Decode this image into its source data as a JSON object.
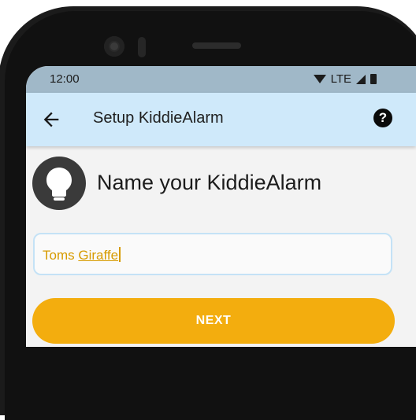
{
  "status_bar": {
    "time": "12:00",
    "network": "LTE",
    "icons": [
      "wifi-icon",
      "signal-icon",
      "battery-icon"
    ]
  },
  "app_bar": {
    "title": "Setup KiddieAlarm",
    "back_icon": "back-arrow-icon",
    "help_icon": "help-icon",
    "help_glyph": "?"
  },
  "content": {
    "heading_icon": "lightbulb-icon",
    "heading": "Name your KiddieAlarm",
    "name_input": {
      "value_word1": "Toms",
      "value_word2": "Giraffe"
    },
    "next_label": "NEXT"
  },
  "colors": {
    "app_bar": "#cfe9fa",
    "status_bar": "#a0b8c8",
    "accent": "#f3ad0e",
    "input_text": "#d79b00"
  }
}
